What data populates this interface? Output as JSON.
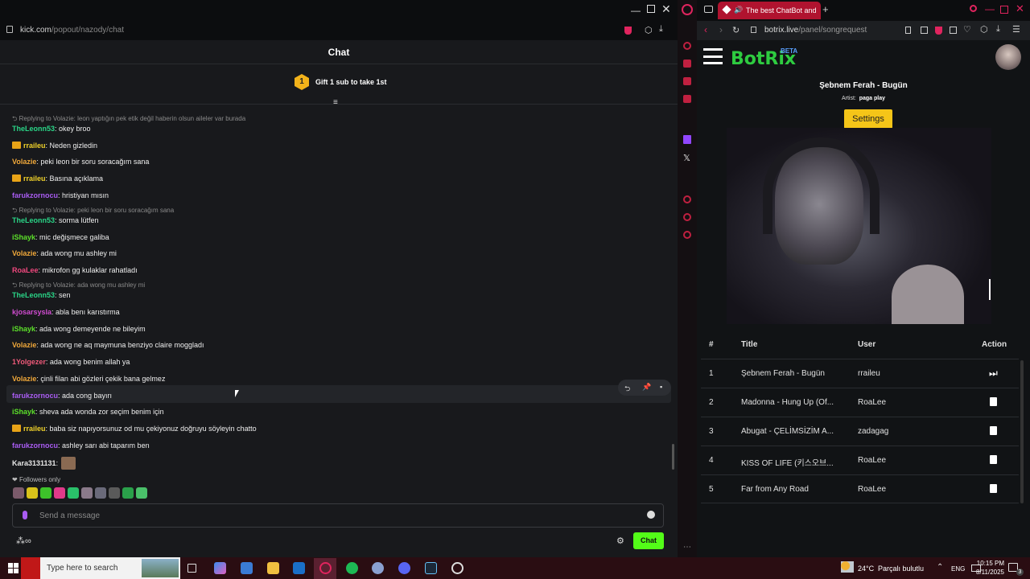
{
  "left_window": {
    "url_host": "kick.com",
    "url_path": "/popout/nazody/chat",
    "chat_title": "Chat",
    "gift_rank": "1",
    "gift_text": "Gift 1 sub to take 1st",
    "messages": [
      {
        "reply": "Replying to Volazie: leon yaptığın pek etik değil haberin olsun aileler var burada"
      },
      {
        "user": "TheLeonn53",
        "color": "#2ad587",
        "text": ": okey broo"
      },
      {
        "user": "rraileu",
        "color": "#efd12a",
        "text": ": Neden gizledin",
        "badge": true
      },
      {
        "user": "Volazie",
        "color": "#f0a83a",
        "text": ": peki leon bir soru soracağım sana"
      },
      {
        "user": "rraileu",
        "color": "#efd12a",
        "text": ": Basına açıklama",
        "badge": true
      },
      {
        "user": "farukzornocu",
        "color": "#a95cf2",
        "text": ": hristiyan mısın"
      },
      {
        "reply": "Replying to Volazie: peki leon bir soru soracağım sana"
      },
      {
        "user": "TheLeonn53",
        "color": "#2ad587",
        "text": ": sorma lütfen"
      },
      {
        "user": "iShayk",
        "color": "#5ce02a",
        "text": ": mic değişmece galiba"
      },
      {
        "user": "Volazie",
        "color": "#f0a83a",
        "text": ": ada wong mu ashley mi"
      },
      {
        "user": "RoaLee",
        "color": "#f0487e",
        "text": ": mikrofon gg kulaklar rahatladı"
      },
      {
        "reply": "Replying to Volazie: ada wong mu ashley mi"
      },
      {
        "user": "TheLeonn53",
        "color": "#2ad587",
        "text": ": sen"
      },
      {
        "user": "kjosarsysla",
        "color": "#d04cd0",
        "text": ": abla benı karıstırma"
      },
      {
        "user": "iShayk",
        "color": "#5ce02a",
        "text": ": ada wong demeyende ne bileyim"
      },
      {
        "user": "Volazie",
        "color": "#f0a83a",
        "text": ": ada wong ne aq maymuna benziyo claire moggladı"
      },
      {
        "user": "1Yolgezer",
        "color": "#f05a7a",
        "text": ": ada wong benim allah ya"
      },
      {
        "user": "Volazie",
        "color": "#f0a83a",
        "text": ": çinli filan abi gözleri çekik bana gelmez"
      },
      {
        "user": "farukzornocu",
        "color": "#a95cf2",
        "text": ": ada cong bayırı"
      },
      {
        "user": "iShayk",
        "color": "#5ce02a",
        "text": ": sheva ada wonda zor seçim benim için"
      },
      {
        "user": "rraileu",
        "color": "#efd12a",
        "text": ": baba siz napıyorsunuz od mu çekiyonuz doğruyu söyleyin chatto",
        "badge": true
      },
      {
        "user": "farukzornocu",
        "color": "#a95cf2",
        "text": ": ashley sarı abi taparım ben"
      },
      {
        "user": "Kara3131131",
        "color": "#e8e8e8",
        "text": ":"
      }
    ],
    "followers_only": "Followers only",
    "message_placeholder": "Send a message",
    "chat_button": "Chat"
  },
  "right_window": {
    "tab_title": "The best ChatBot and",
    "url_host": "botrix.live",
    "url_path": "/panel/songrequest",
    "logo_text": "BotRix",
    "logo_badge": "BETA",
    "now_playing_title": "Şebnem Ferah - Bugün",
    "artist_label": "Artist:",
    "artist_value": "paga play",
    "settings_button": "Settings",
    "table_headers": {
      "num": "#",
      "title": "Title",
      "user": "User",
      "action": "Action"
    },
    "queue": [
      {
        "num": "1",
        "title": "Şebnem Ferah - Bugün",
        "user": "rraileu",
        "action": "skip-icon"
      },
      {
        "num": "2",
        "title": "Madonna - Hung Up (Of...",
        "user": "RoaLee",
        "action": "trash-icon"
      },
      {
        "num": "3",
        "title": "Abugat - ÇELİMSİZİM A...",
        "user": "zadagag",
        "action": "trash-icon"
      },
      {
        "num": "4",
        "title": "KISS OF LIFE (키스오브...",
        "user": "RoaLee",
        "action": "trash-icon"
      },
      {
        "num": "5",
        "title": "Far from Any Road",
        "user": "RoaLee",
        "action": "trash-icon"
      }
    ]
  },
  "taskbar": {
    "search_placeholder": "Type here to search",
    "temperature": "24°C",
    "weather": "Parçalı bulutlu",
    "language": "ENG",
    "time": "10:15 PM",
    "date": "8/11/2025",
    "notifications": "3"
  },
  "colors": {
    "kick_green": "#53fc18",
    "botrix_green": "#2ecc40",
    "settings_yellow": "#f5c518"
  }
}
